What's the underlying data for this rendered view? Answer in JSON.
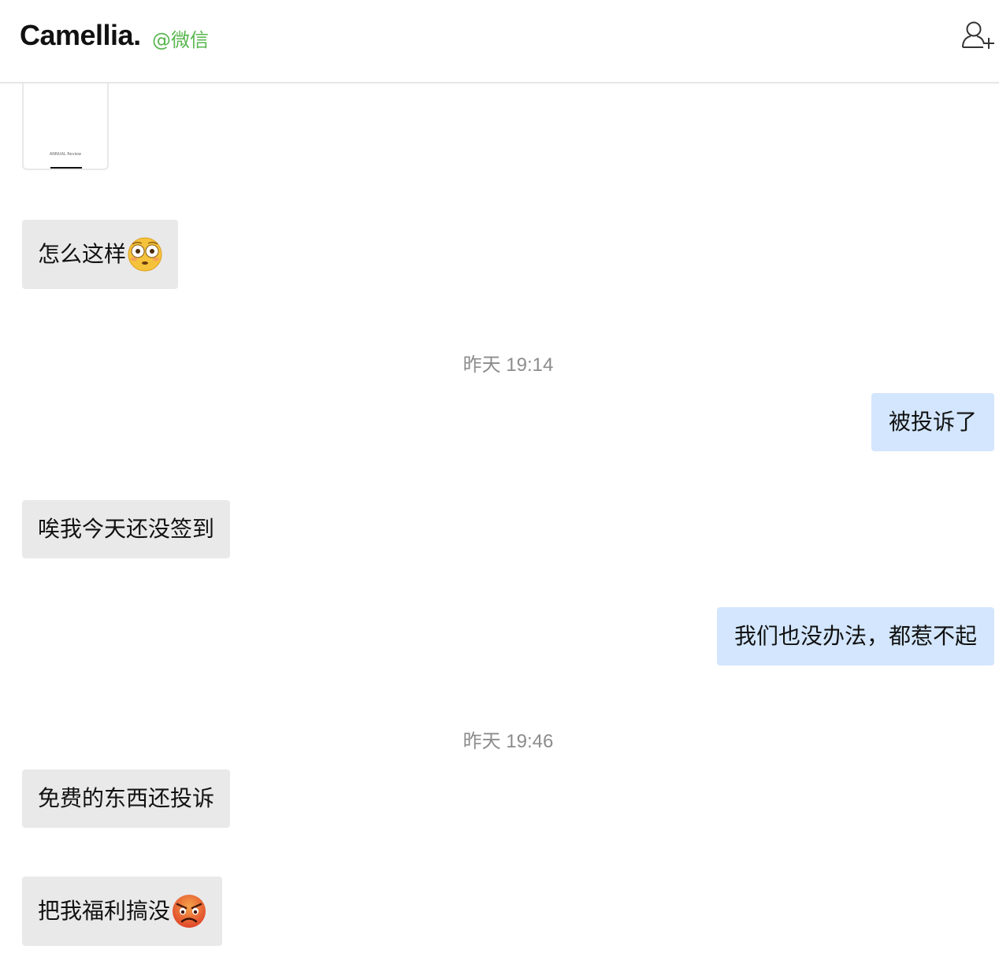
{
  "header": {
    "contact_name": "Camellia.",
    "source_label": "@微信",
    "add_contact_icon": "add-user-icon"
  },
  "image_message": {
    "caption": "ANNUAL Review"
  },
  "messages": [
    {
      "direction": "incoming",
      "text": "怎么这样",
      "emoji": "flushed-face-emoji"
    },
    {
      "type": "timestamp",
      "text": "昨天 19:14"
    },
    {
      "direction": "outgoing",
      "text": "被投诉了"
    },
    {
      "direction": "incoming",
      "text": "唉我今天还没签到"
    },
    {
      "direction": "outgoing",
      "text": "我们也没办法，都惹不起"
    },
    {
      "type": "timestamp",
      "text": "昨天 19:46"
    },
    {
      "direction": "incoming",
      "text": "免费的东西还投诉"
    },
    {
      "direction": "incoming",
      "text": "把我福利搞没",
      "emoji": "angry-face-emoji"
    }
  ],
  "colors": {
    "incoming_bubble": "#e9e9e9",
    "outgoing_bubble": "#d3e6fd",
    "source_green": "#57b64e",
    "timestamp_gray": "#8c8c8c"
  }
}
